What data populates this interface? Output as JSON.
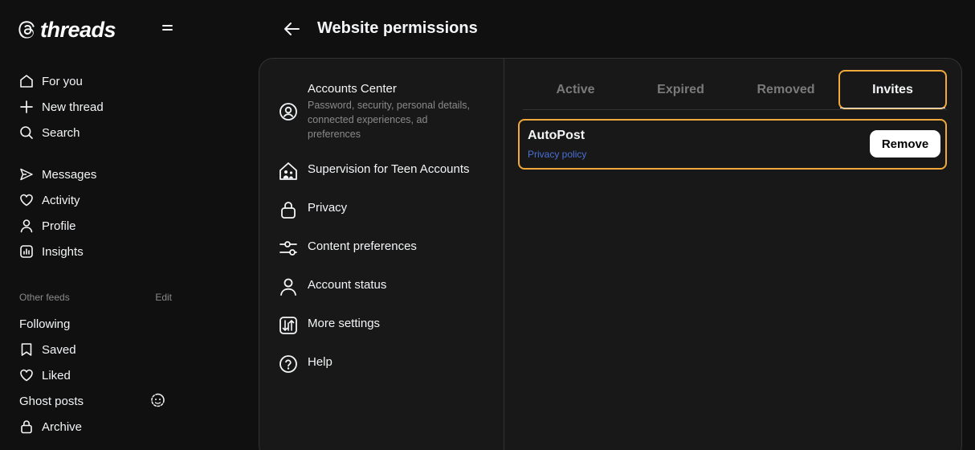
{
  "app": {
    "name": "threads"
  },
  "sidebar": {
    "main_items": [
      {
        "label": "For you",
        "icon": "home-icon"
      },
      {
        "label": "New thread",
        "icon": "plus-icon"
      },
      {
        "label": "Search",
        "icon": "search-icon"
      }
    ],
    "secondary_items": [
      {
        "label": "Messages",
        "icon": "send-icon"
      },
      {
        "label": "Activity",
        "icon": "heart-icon"
      },
      {
        "label": "Profile",
        "icon": "person-icon"
      },
      {
        "label": "Insights",
        "icon": "insights-icon"
      }
    ],
    "feeds_header": "Other feeds",
    "feeds_edit": "Edit",
    "feeds": [
      {
        "label": "Following"
      },
      {
        "label": "Saved",
        "icon": "bookmark-icon"
      },
      {
        "label": "Liked",
        "icon": "heart-icon"
      },
      {
        "label": "Ghost posts",
        "icon": "ghost-icon"
      },
      {
        "label": "Archive",
        "icon": "lock-icon"
      }
    ]
  },
  "header": {
    "title": "Website permissions"
  },
  "settings": [
    {
      "label": "Accounts Center",
      "description": "Password, security, personal details, connected experiences, ad preferences",
      "icon": "account-circle-icon"
    },
    {
      "label": "Supervision for Teen Accounts",
      "icon": "family-home-icon"
    },
    {
      "label": "Privacy",
      "icon": "lock-icon"
    },
    {
      "label": "Content preferences",
      "icon": "sliders-icon"
    },
    {
      "label": "Account status",
      "icon": "person-icon"
    },
    {
      "label": "More settings",
      "icon": "more-settings-icon"
    },
    {
      "label": "Help",
      "icon": "help-icon"
    }
  ],
  "tabs": [
    {
      "label": "Active"
    },
    {
      "label": "Expired"
    },
    {
      "label": "Removed"
    },
    {
      "label": "Invites",
      "selected": true
    }
  ],
  "permission": {
    "name": "AutoPost",
    "link": "Privacy policy",
    "button": "Remove"
  },
  "colors": {
    "highlight": "#f0a93a",
    "link": "#4a6fd6",
    "background": "#101010"
  }
}
